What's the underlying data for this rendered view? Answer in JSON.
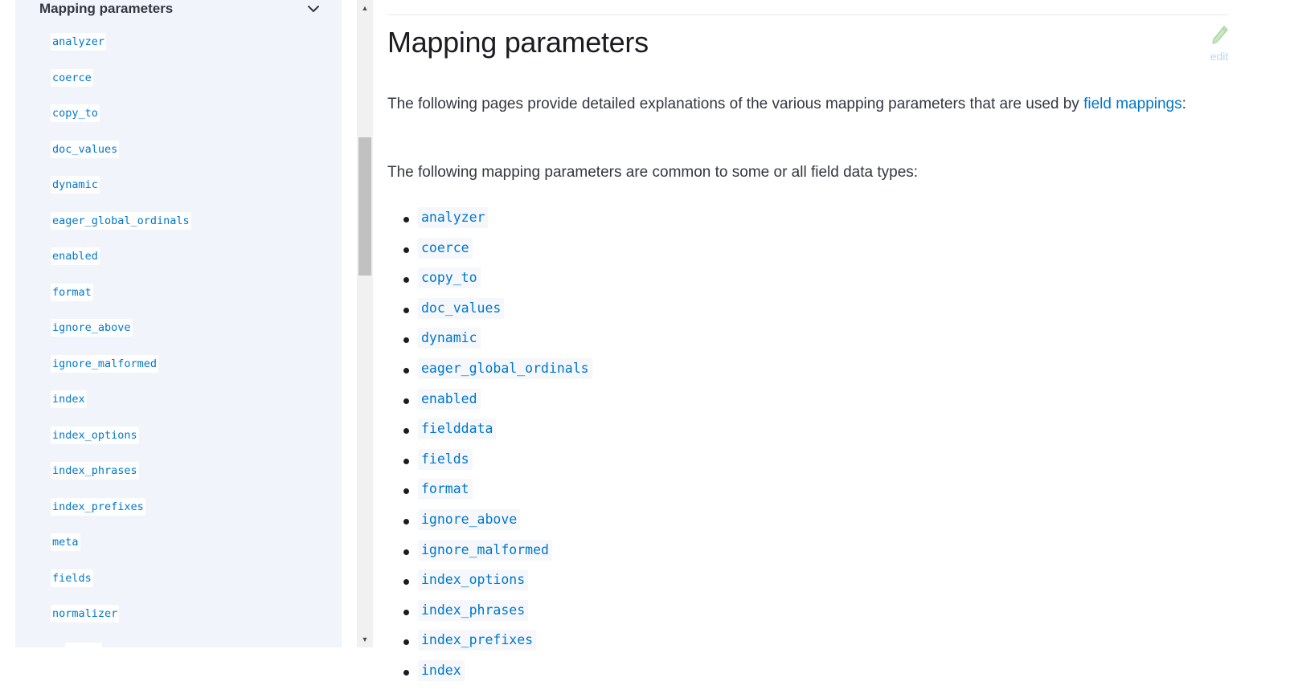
{
  "sidebar": {
    "section_title": "Mapping parameters",
    "items": [
      {
        "label": "analyzer"
      },
      {
        "label": "coerce"
      },
      {
        "label": "copy_to"
      },
      {
        "label": "doc_values"
      },
      {
        "label": "dynamic"
      },
      {
        "label": "eager_global_ordinals"
      },
      {
        "label": "enabled"
      },
      {
        "label": "format"
      },
      {
        "label": "ignore_above"
      },
      {
        "label": "ignore_malformed"
      },
      {
        "label": "index"
      },
      {
        "label": "index_options"
      },
      {
        "label": "index_phrases"
      },
      {
        "label": "index_prefixes"
      },
      {
        "label": "meta"
      },
      {
        "label": "fields"
      },
      {
        "label": "normalizer"
      }
    ]
  },
  "scrollbar": {
    "up_glyph": "▲",
    "down_glyph": "▼"
  },
  "content": {
    "title": "Mapping parameters",
    "edit_label": "edit",
    "intro_before": "The following pages provide detailed explanations of the various mapping parameters that are used by ",
    "intro_link": "field mappings",
    "intro_after": ":",
    "common_text": "The following mapping parameters are common to some or all field data types:",
    "params": [
      {
        "label": "analyzer"
      },
      {
        "label": "coerce"
      },
      {
        "label": "copy_to"
      },
      {
        "label": "doc_values"
      },
      {
        "label": "dynamic"
      },
      {
        "label": "eager_global_ordinals"
      },
      {
        "label": "enabled"
      },
      {
        "label": "fielddata"
      },
      {
        "label": "fields"
      },
      {
        "label": "format"
      },
      {
        "label": "ignore_above"
      },
      {
        "label": "ignore_malformed"
      },
      {
        "label": "index_options"
      },
      {
        "label": "index_phrases"
      },
      {
        "label": "index_prefixes"
      },
      {
        "label": "index"
      }
    ]
  },
  "colors": {
    "link": "#0077cc",
    "sidebar_bg": "#f1f4fa",
    "code_bg": "#f5f7fa",
    "edit_icon": "#a8d8a0"
  },
  "icons": {
    "section_toggle": "chevron-down-icon",
    "edit": "pencil-icon"
  }
}
